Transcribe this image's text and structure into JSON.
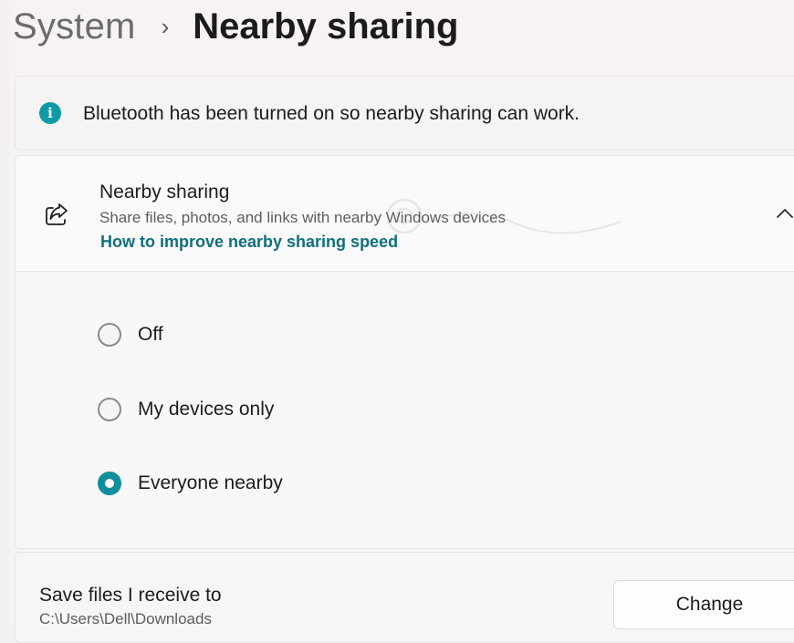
{
  "breadcrumb": {
    "parent": "System",
    "separator": "›",
    "current": "Nearby sharing"
  },
  "info_bar": {
    "icon": "info-icon",
    "icon_glyph": "i",
    "message": "Bluetooth has been turned on so nearby sharing can work.",
    "accent_color": "#0f9aa6"
  },
  "nearby_sharing": {
    "icon": "share-icon",
    "title": "Nearby sharing",
    "description": "Share files, photos, and links with nearby Windows devices",
    "link": "How to improve nearby sharing speed",
    "expanded": true
  },
  "options": [
    {
      "label": "Off",
      "selected": false
    },
    {
      "label": "My devices only",
      "selected": false
    },
    {
      "label": "Everyone nearby",
      "selected": true
    }
  ],
  "save_location": {
    "title": "Save files I receive to",
    "path": "C:\\Users\\Dell\\Downloads",
    "button_label": "Change"
  },
  "colors": {
    "accent": "#0f8f9c",
    "link": "#0e6f7d"
  }
}
